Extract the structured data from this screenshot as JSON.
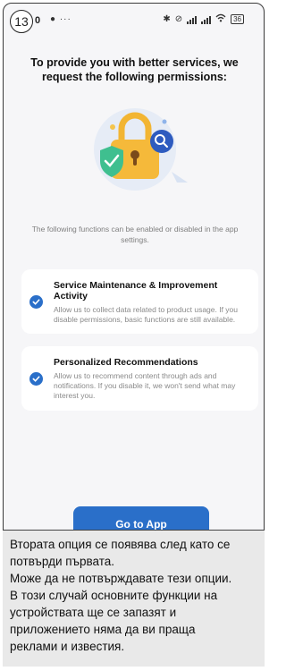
{
  "status_bar": {
    "step_number": "13",
    "time": "0",
    "left_icons": "● ···",
    "right_icons": [
      "bluetooth-icon",
      "alarm-icon",
      "signal-icon",
      "signal-icon",
      "wifi-icon"
    ],
    "battery": "36"
  },
  "headline": "To provide you with better services, we request the following permissions:",
  "info_text": "The following functions can be enabled or disabled in the app settings.",
  "permissions": [
    {
      "title": "Service Maintenance & Improvement Activity",
      "description": "Allow us to collect data related to product usage. If you disable permissions, basic functions are still available.",
      "checked": true
    },
    {
      "title": "Personalized Recommendations",
      "description": "Allow us to recommend content through ads and notifications. If you disable it, we won't send what may interest you.",
      "checked": true
    }
  ],
  "primary_button": "Go to App",
  "note": [
    "Втората опция се появява след като се",
    "потвърди първата.",
    "Може да не потвърждавате тези опции.",
    "В този случай основните функции на",
    "устройствата ще се запазят и",
    "приложението няма да ви праща",
    "реклами и известия."
  ],
  "colors": {
    "accent": "#2a6fc9",
    "shield": "#3fbf8f",
    "lock": "#f2b533"
  }
}
